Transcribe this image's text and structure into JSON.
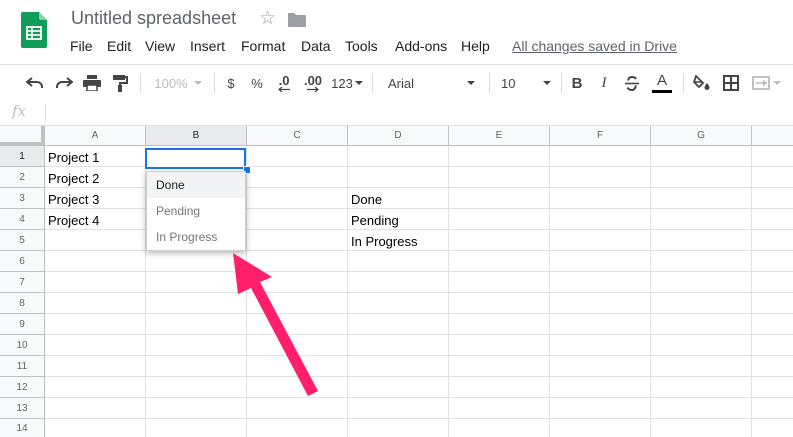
{
  "header": {
    "title": "Untitled spreadsheet",
    "menu": [
      "File",
      "Edit",
      "View",
      "Insert",
      "Format",
      "Data",
      "Tools",
      "Add-ons",
      "Help"
    ],
    "save_status": "All changes saved in Drive"
  },
  "toolbar": {
    "zoom": "100%",
    "currency": "$",
    "percent": "%",
    "decrease_decimals": ".0",
    "increase_decimals": ".00",
    "more_formats": "123",
    "font": "Arial",
    "font_size": "10",
    "bold": "B",
    "italic": "I",
    "text_color": "A"
  },
  "formula_bar": {
    "fx": "fx",
    "value": ""
  },
  "grid": {
    "columns": [
      "A",
      "B",
      "C",
      "D",
      "E",
      "F",
      "G"
    ],
    "rows": [
      "1",
      "2",
      "3",
      "4",
      "5",
      "6",
      "7",
      "8",
      "9",
      "10",
      "11",
      "12",
      "13",
      "14"
    ],
    "column_a": [
      "Project 1",
      "Project 2",
      "Project 3",
      "Project 4"
    ],
    "column_d": [
      "Done",
      "Pending",
      "In Progress"
    ]
  },
  "dropdown": {
    "options": [
      "Done",
      "Pending",
      "In Progress"
    ]
  },
  "colors": {
    "accent": "#1a73e8",
    "sheets_green": "#0f9d58",
    "arrow": "#ff1f6b"
  }
}
